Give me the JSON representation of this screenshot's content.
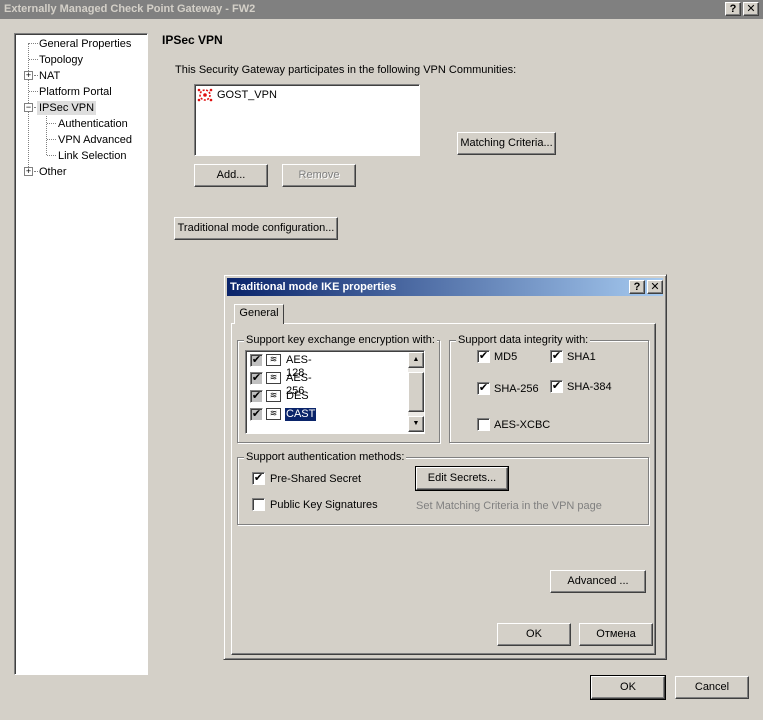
{
  "window": {
    "title": "Externally Managed Check Point Gateway - FW2",
    "help_btn": "?",
    "close_btn": "✕"
  },
  "tree": {
    "items": [
      {
        "label": "General Properties"
      },
      {
        "label": "Topology"
      },
      {
        "label": "NAT"
      },
      {
        "label": "Platform Portal"
      },
      {
        "label": "IPSec VPN"
      },
      {
        "label": "Authentication"
      },
      {
        "label": "VPN Advanced"
      },
      {
        "label": "Link Selection"
      },
      {
        "label": "Other"
      }
    ],
    "expander": "+",
    "collapser": "−"
  },
  "page": {
    "heading": "IPSec VPN",
    "communities_label": "This Security Gateway participates in the following VPN Communities:",
    "communities": [
      {
        "name": "GOST_VPN",
        "icon": "vpn-community-icon"
      }
    ],
    "matching_criteria": "Matching Criteria...",
    "add": "Add...",
    "remove": "Remove",
    "traditional_mode": "Traditional mode configuration..."
  },
  "dialog": {
    "title": "Traditional mode IKE properties",
    "help_btn": "?",
    "close_btn": "✕",
    "tab_general": "General",
    "key_exchange": {
      "label": "Support key exchange encryption with:",
      "items": [
        {
          "label": "AES-128",
          "checked": true
        },
        {
          "label": "AES-256",
          "checked": true
        },
        {
          "label": "DES",
          "checked": true
        },
        {
          "label": "CAST",
          "checked": true
        }
      ],
      "scroll_up": "▲",
      "scroll_down": "▼"
    },
    "integrity": {
      "label": "Support data integrity with:",
      "md5": "MD5",
      "sha1": "SHA1",
      "sha256": "SHA-256",
      "sha384": "SHA-384",
      "aes_xcbc": "AES-XCBC"
    },
    "auth": {
      "label": "Support authentication methods:",
      "pre_shared": "Pre-Shared Secret",
      "edit_secrets": "Edit Secrets...",
      "public_key": "Public Key Signatures",
      "hint": "Set Matching Criteria in the VPN page"
    },
    "advanced": "Advanced ...",
    "ok": "OK",
    "cancel": "Отмена"
  },
  "footer": {
    "ok": "OK",
    "cancel": "Cancel"
  },
  "check_mark": "✔"
}
